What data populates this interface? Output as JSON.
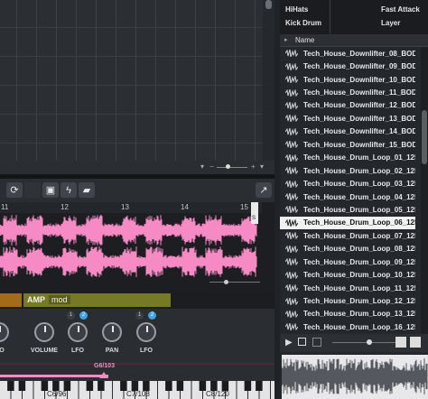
{
  "tags": {
    "row1_left": "HiHats",
    "row1_right": "Fast Attack",
    "row2_left": "Kick Drum",
    "row2_right": "Layer"
  },
  "browser": {
    "column_header": "Name",
    "files": [
      "Tech_House_Downlifter_08_BODTH",
      "Tech_House_Downlifter_09_BODTH",
      "Tech_House_Downlifter_10_BODTH",
      "Tech_House_Downlifter_11_BODTH",
      "Tech_House_Downlifter_12_BODTH",
      "Tech_House_Downlifter_13_BODTH",
      "Tech_House_Downlifter_14_BODTH",
      "Tech_House_Downlifter_15_BODTH",
      "Tech_House_Drum_Loop_01_125bpm",
      "Tech_House_Drum_Loop_02_125bpm",
      "Tech_House_Drum_Loop_03_125bpm",
      "Tech_House_Drum_Loop_04_125bpm",
      "Tech_House_Drum_Loop_05_125bpm",
      "Tech_House_Drum_Loop_06_125bpm",
      "Tech_House_Drum_Loop_07_125bpm",
      "Tech_House_Drum_Loop_08_125bpm",
      "Tech_House_Drum_Loop_09_125bpm",
      "Tech_House_Drum_Loop_10_125bpm",
      "Tech_House_Drum_Loop_11_125bpm",
      "Tech_House_Drum_Loop_12_125bpm",
      "Tech_House_Drum_Loop_13_125bpm",
      "Tech_House_Drum_Loop_16_125bpm",
      "Tech_House_Drum_Loop_17_125bpm"
    ],
    "selected_index": 13
  },
  "ruler": {
    "ticks": [
      "11",
      "12",
      "13",
      "14",
      "15"
    ],
    "marker": "S"
  },
  "sampler": {
    "amp_label": "AMP",
    "mod_label": "mod",
    "knobs": {
      "volume": "VOLUME",
      "lfo1": "LFO",
      "pan": "PAN",
      "lfo2": "LFO",
      "partial": "O"
    },
    "badges": {
      "b1": "1",
      "b2": "2",
      "b3": "1",
      "b4": "2"
    },
    "range_label": "G6/103",
    "key_labels": {
      "k1": "C6/96",
      "k2": "C7/108",
      "k3": "C8/120"
    }
  },
  "colors": {
    "waveform": "#f58ac4",
    "accent_blue": "#3fa4e6",
    "amp_bar": "#767a24",
    "selection": "#f1f1f1"
  }
}
